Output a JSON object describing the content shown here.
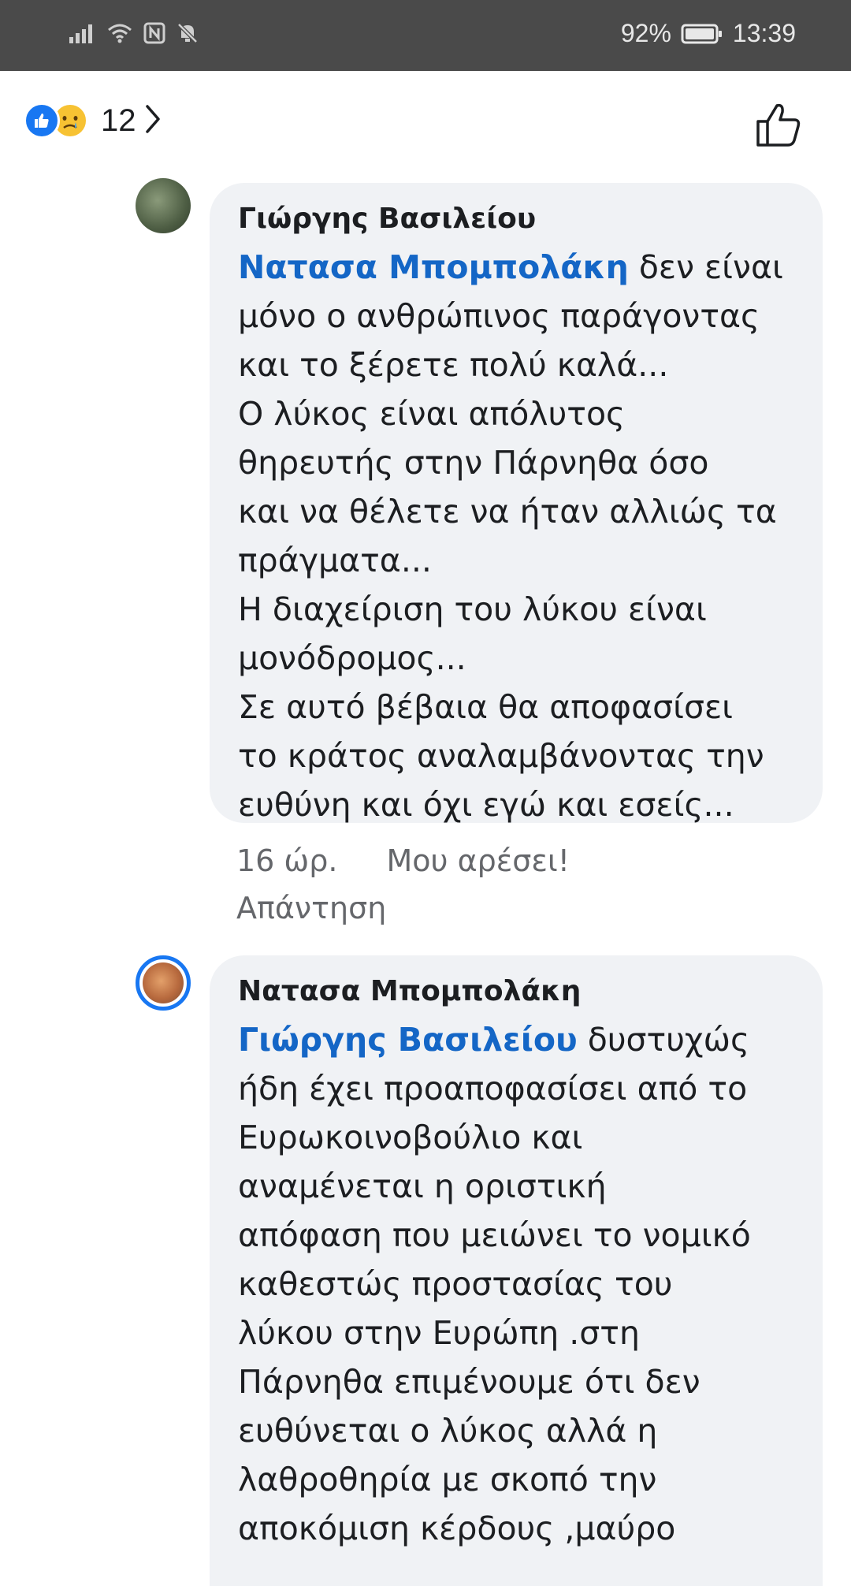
{
  "status_bar": {
    "battery": "92%",
    "time": "13:39"
  },
  "reactions": {
    "count": "12",
    "icons": [
      "like-icon",
      "sad-icon"
    ]
  },
  "comments": [
    {
      "author": "Γιώργης Βασιλείου",
      "mention": "Νατασα Μπομπολάκη",
      "text": " δεν είναι\nμόνο ο ανθρώπινος παράγοντας\nκαι το ξέρετε πολύ καλά...\nΟ λύκος είναι απόλυτος\nθηρευτής στην Πάρνηθα όσο\nκαι να θέλετε να ήταν αλλιώς τα\nπράγματα...\nΗ διαχείριση του λύκου είναι\nμονόδρομος...\nΣε αυτό βέβαια θα αποφασίσει\nτο κράτος αναλαμβάνοντας την\nευθύνη και όχι εγώ και εσείς...",
      "time": "16 ώρ.",
      "like_label": "Μου αρέσει!",
      "reply_label": "Απάντηση"
    },
    {
      "author": "Νατασα Μπομπολάκη",
      "mention": "Γιώργης Βασιλείου",
      "text": " δυστυχώς\nήδη έχει προαποφασίσει από το\nΕυρωκοινοβούλιο και\nαναμένεται η οριστική\nαπόφαση που μειώνει το νομικό\nκαθεστώς προστασίας του\nλύκου στην Ευρώπη .στη\nΠάρνηθα επιμένουμε ότι δεν\nευθύνεται ο λύκος αλλά η\nλαθροθηρία με σκοπό την\nαποκόμιση κέρδους ,μαύρο"
    }
  ]
}
